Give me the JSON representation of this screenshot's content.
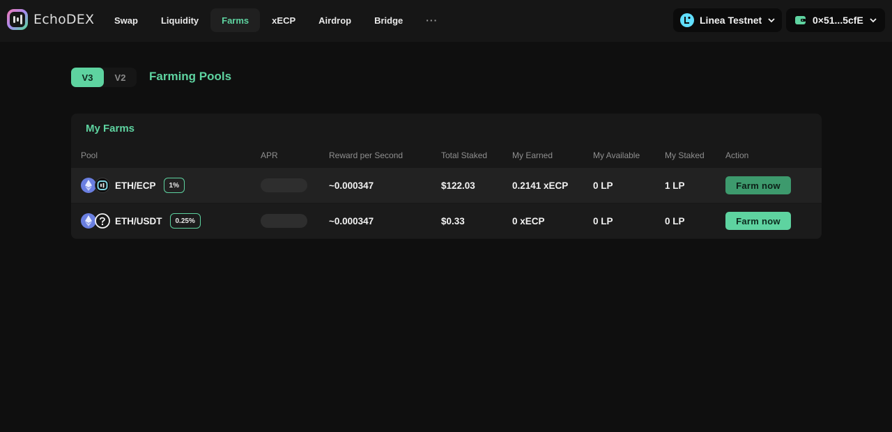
{
  "brand": {
    "name": "EchoDEX"
  },
  "nav": {
    "items": [
      {
        "label": "Swap",
        "active": false
      },
      {
        "label": "Liquidity",
        "active": false
      },
      {
        "label": "Farms",
        "active": true
      },
      {
        "label": "xECP",
        "active": false
      },
      {
        "label": "Airdrop",
        "active": false
      },
      {
        "label": "Bridge",
        "active": false
      }
    ],
    "more_label": "···"
  },
  "network": {
    "label": "Linea Testnet",
    "icon": "linea-icon"
  },
  "wallet": {
    "address": "0×51...5cfE",
    "icon": "wallet-icon"
  },
  "version_toggle": {
    "options": [
      "V3",
      "V2"
    ],
    "selected": "V3"
  },
  "page": {
    "title": "Farming Pools"
  },
  "farms": {
    "title": "My Farms",
    "columns": [
      "Pool",
      "APR",
      "Reward per Second",
      "Total Staked",
      "My Earned",
      "My Available",
      "My Staked",
      "Action"
    ],
    "rows": [
      {
        "pool": "ETH/ECP",
        "fee": "1%",
        "token_icons": [
          "eth-icon",
          "ecp-icon"
        ],
        "reward_per_second": "~0.000347",
        "total_staked": "$122.03",
        "my_earned": "0.2141 xECP",
        "my_available": "0 LP",
        "my_staked": "1 LP",
        "action": "Farm now"
      },
      {
        "pool": "ETH/USDT",
        "fee": "0.25%",
        "token_icons": [
          "eth-icon",
          "unknown-token-icon"
        ],
        "reward_per_second": "~0.000347",
        "total_staked": "$0.33",
        "my_earned": "0 xECP",
        "my_available": "0 LP",
        "my_staked": "0 LP",
        "action": "Farm now"
      }
    ]
  },
  "colors": {
    "accent": "#5ed3a0",
    "background": "#0f0f0f",
    "header": "#161616",
    "card": "#181818"
  }
}
